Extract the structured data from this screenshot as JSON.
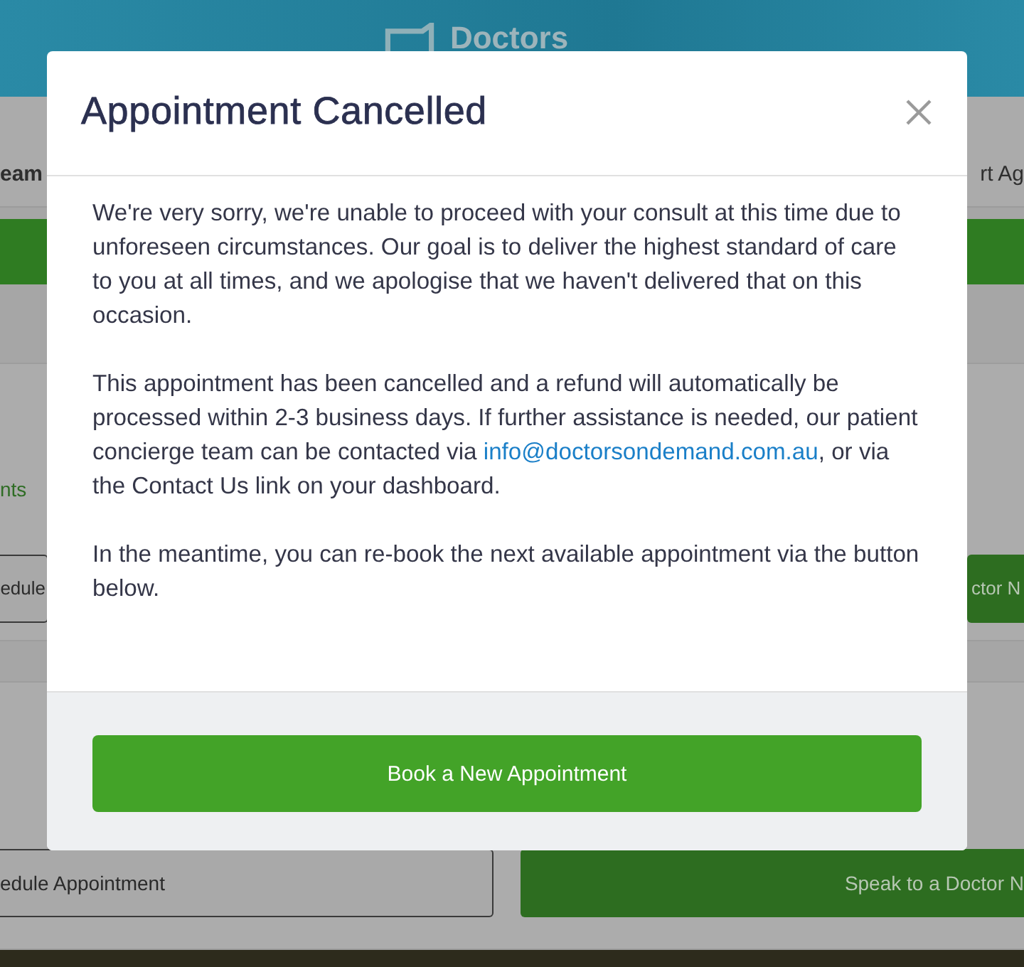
{
  "background": {
    "logo_text": "Doctors",
    "tabs": [
      {
        "label": "eam"
      },
      {
        "label": "rt Ag"
      }
    ],
    "link": "nts",
    "buttons": [
      {
        "label": "edule",
        "kind": "outline"
      },
      {
        "label": "ctor N",
        "kind": "filled"
      },
      {
        "label": "edule Appointment",
        "kind": "outline"
      },
      {
        "label": "Speak to a Doctor N",
        "kind": "filled"
      }
    ]
  },
  "dialog": {
    "title": "Appointment Cancelled",
    "paragraphs": [
      {
        "text": "We're very sorry, we're unable to proceed with your consult at this time due to unforeseen circumstances. Our goal is to deliver the highest standard of care to you at all times, and we apologise that we haven't delivered that on this occasion."
      },
      {
        "text": "This appointment has been cancelled and a refund will automatically be processed within 2-3 business days. If further assistance is needed, our patient concierge team can be contacted via ",
        "link": "info@doctorsondemand.com.au",
        "after": ", or via the Contact Us link on your dashboard."
      },
      {
        "text": "In the meantime, you can re-book the next available appointment via the button below."
      }
    ],
    "button": "Book a New Appointment"
  }
}
